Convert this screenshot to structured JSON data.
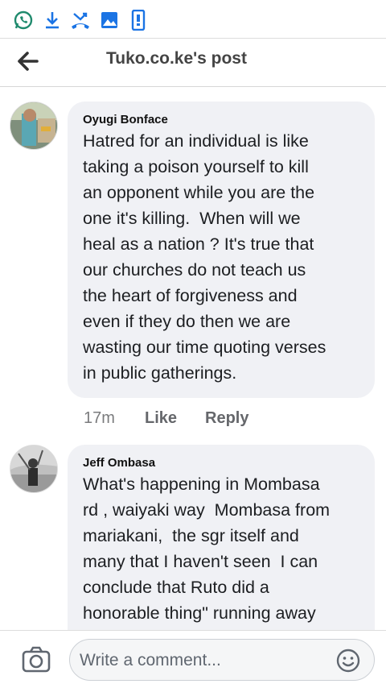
{
  "header": {
    "title": "Tuko.co.ke's post"
  },
  "comments": [
    {
      "name": "Oyugi Bonface",
      "text": "Hatred for an individual is like\ntaking a poison yourself to kill\nan opponent while you are the\none it's killing.  When will we\nheal as a nation ? It's true that\nour churches do not teach us\nthe heart of forgiveness and\neven if they do then we are\nwasting our time quoting verses\nin public gatherings.",
      "time": "17m",
      "like": "Like",
      "reply": "Reply"
    },
    {
      "name": "Jeff Ombasa",
      "text": "What's happening in Mombasa\nrd , waiyaki way  Mombasa from\nmariakani,  the sgr itself and\nmany that I haven't seen  I can\nconclude that Ruto did a\nhonorable thing\" running away"
    }
  ],
  "composer": {
    "placeholder": "Write a comment..."
  },
  "icons": {
    "status": [
      "whatsapp-icon",
      "download-icon",
      "missed-call-icon",
      "image-icon",
      "phone-notification-icon"
    ],
    "accent": "#1b74e4"
  }
}
